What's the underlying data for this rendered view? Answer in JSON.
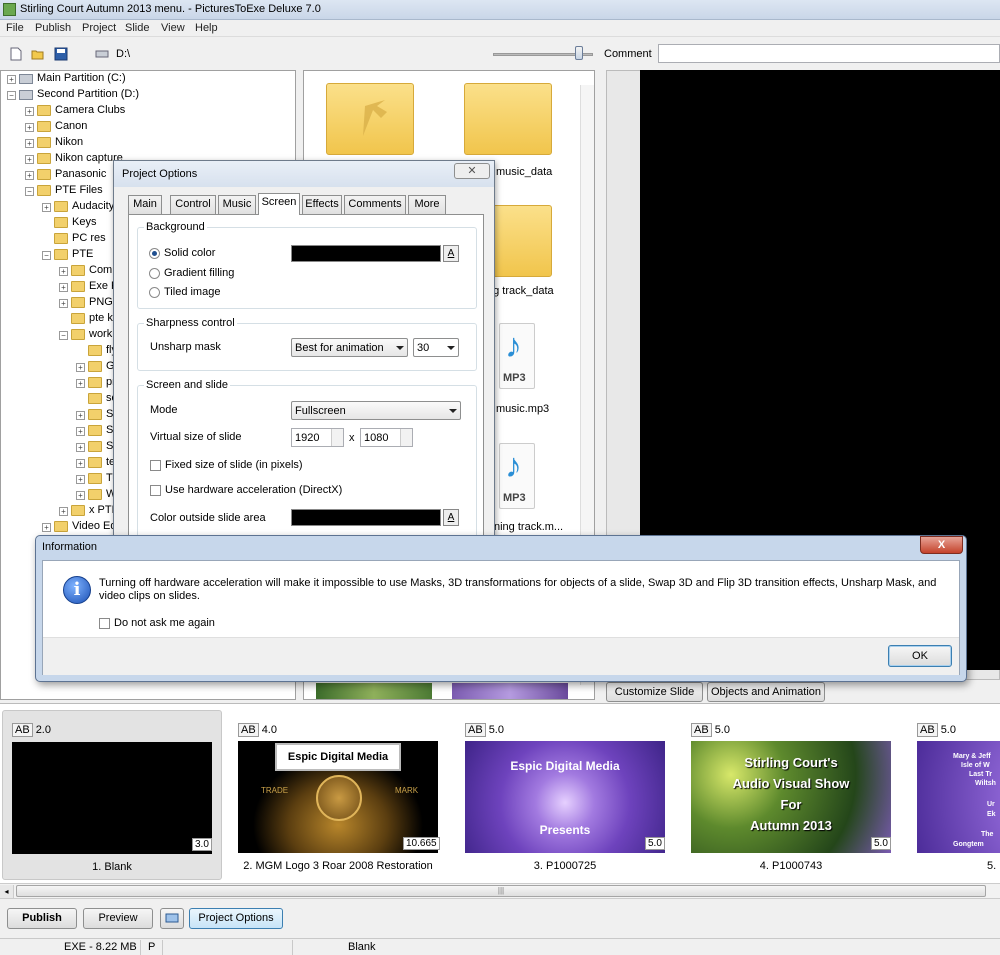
{
  "window": {
    "title": "Stirling Court Autumn 2013 menu. - PicturesToExe Deluxe 7.0"
  },
  "menu": [
    "File",
    "Publish",
    "Project",
    "Slide",
    "View",
    "Help"
  ],
  "toolbar": {
    "path": "D:\\",
    "comment_label": "Comment",
    "comment_value": ""
  },
  "tree": [
    {
      "label": "Main Partition (C:)",
      "level": 0,
      "kind": "drive"
    },
    {
      "label": "Second Partition (D:)",
      "level": 0,
      "kind": "drive"
    },
    {
      "label": "Camera Clubs",
      "level": 1
    },
    {
      "label": "Canon",
      "level": 1
    },
    {
      "label": "Nikon",
      "level": 1
    },
    {
      "label": "Nikon capture",
      "level": 1
    },
    {
      "label": "Panasonic",
      "level": 1
    },
    {
      "label": "PTE Files",
      "level": 1
    },
    {
      "label": "Audacity",
      "level": 2
    },
    {
      "label": "Keys",
      "level": 2
    },
    {
      "label": "PC res",
      "level": 2
    },
    {
      "label": "PTE",
      "level": 2
    },
    {
      "label": "Comp",
      "level": 3
    },
    {
      "label": "Exe Fi",
      "level": 3
    },
    {
      "label": "PNG .",
      "level": 3
    },
    {
      "label": "pte ke",
      "level": 3
    },
    {
      "label": "work",
      "level": 3
    },
    {
      "label": "fly",
      "level": 4
    },
    {
      "label": "Ge",
      "level": 4
    },
    {
      "label": "pr",
      "level": 4
    },
    {
      "label": "so",
      "level": 4
    },
    {
      "label": "St",
      "level": 4
    },
    {
      "label": "St",
      "level": 4
    },
    {
      "label": "St",
      "level": 4
    },
    {
      "label": "te",
      "level": 4
    },
    {
      "label": "Tu",
      "level": 4
    },
    {
      "label": "W",
      "level": 4
    },
    {
      "label": "x PTE",
      "level": 3
    },
    {
      "label": "Video Edi",
      "level": 2
    }
  ],
  "files": [
    {
      "label": "",
      "type": "folder-back"
    },
    {
      "label": "music_data",
      "type": "folder"
    },
    {
      "label": "",
      "type": "folder"
    },
    {
      "label": "ng track_data",
      "type": "folder"
    },
    {
      "label": "music.mp3",
      "type": "mp3"
    },
    {
      "label": "ning track.m...",
      "type": "mp3"
    }
  ],
  "mp3_text": "MP3",
  "customize": {
    "customize_slide": "Customize Slide",
    "objects_animation": "Objects and Animation"
  },
  "project_options": {
    "title": "Project Options",
    "tabs": [
      "Main",
      "Control",
      "Music",
      "Screen",
      "Effects",
      "Comments",
      "More"
    ],
    "active_tab": "Screen",
    "background": {
      "title": "Background",
      "options": [
        "Solid color",
        "Gradient filling",
        "Tiled image"
      ],
      "selected": "Solid color",
      "color": "#000000",
      "a_label": "A"
    },
    "sharpness": {
      "title": "Sharpness control",
      "label": "Unsharp mask",
      "mode": "Best for animation",
      "value": "30"
    },
    "screen": {
      "title": "Screen and slide",
      "mode_label": "Mode",
      "mode": "Fullscreen",
      "virtual_label": "Virtual size of slide",
      "width": "1920",
      "x": "x",
      "height": "1080",
      "fixed_label": "Fixed size of slide (in pixels)",
      "hw_label": "Use hardware acceleration (DirectX)",
      "outside_label": "Color outside slide area",
      "outside_color": "#000000"
    }
  },
  "info": {
    "title": "Information",
    "message": "Turning off hardware acceleration will make it impossible to use Masks, 3D transformations for objects of a slide, Swap 3D and Flip 3D transition effects, Unsharp Mask, and video clips on slides.",
    "checkbox": "Do not ask me again",
    "ok": "OK",
    "close": "X"
  },
  "slides": [
    {
      "ab": "AB",
      "trans": "2.0",
      "dur": "3.0",
      "caption": "1. Blank",
      "kind": "blank"
    },
    {
      "ab": "AB",
      "trans": "4.0",
      "dur": "10.665",
      "caption": "2. MGM Logo 3 Roar 2008 Restoration",
      "kind": "mgm",
      "banner": "Espic Digital Media",
      "trade": "TRADE",
      "mark": "MARK"
    },
    {
      "ab": "AB",
      "trans": "5.0",
      "dur": "5.0",
      "caption": "3. P1000725",
      "kind": "flower",
      "line1": "Espic Digital Media",
      "line2": "Presents"
    },
    {
      "ab": "AB",
      "trans": "5.0",
      "dur": "5.0",
      "caption": "4. P1000743",
      "kind": "green",
      "lines": [
        "Stirling Court's",
        "Audio Visual Show",
        "For",
        "Autumn 2013"
      ]
    },
    {
      "ab": "AB",
      "trans": "5.0",
      "dur": "",
      "caption": "5.",
      "kind": "flower2",
      "lines": [
        "Mary & Jeff",
        "Isle of W",
        "Last Tr",
        "Wiltsh",
        "Ur",
        "Ek",
        "The",
        "Gongtem"
      ]
    }
  ],
  "bottom": {
    "publish": "Publish",
    "preview": "Preview",
    "project_options": "Project Options"
  },
  "status": {
    "exe": "EXE - 8.22 MB",
    "p": "P",
    "slide": "Blank"
  },
  "colors": {
    "accent": "#3c7fb1",
    "folder": "#f2d06b"
  }
}
